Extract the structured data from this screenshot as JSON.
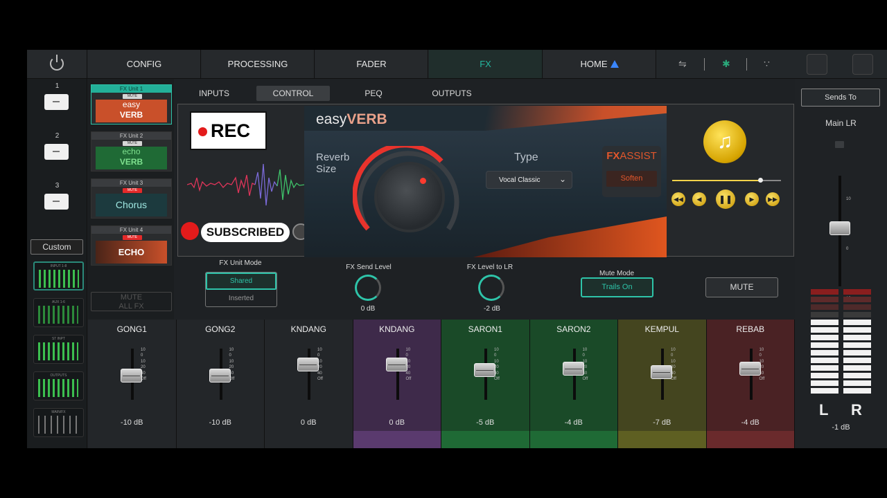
{
  "nav": {
    "tabs": [
      "CONFIG",
      "PROCESSING",
      "FADER",
      "FX",
      "HOME"
    ],
    "active": "FX"
  },
  "banks": [
    {
      "num": "1"
    },
    {
      "num": "2"
    },
    {
      "num": "3"
    }
  ],
  "left": {
    "custom_label": "Custom",
    "thumbs": [
      "INPUT 1-8",
      "AUX 1-6",
      "ST INPT",
      "OUTPUTS",
      "MAIN/FX"
    ]
  },
  "fx_units": [
    {
      "title": "FX Unit 1",
      "mute": "MUTE",
      "art_line1": "easy",
      "art_line2": "VERB",
      "mute_color": "#d6d6d6",
      "art_color": "#e2572c"
    },
    {
      "title": "FX Unit 2",
      "mute": "MUTE",
      "art_line1": "echo",
      "art_line2": "VERB",
      "mute_color": "#d6d6d6",
      "art_color": "#34b54a"
    },
    {
      "title": "FX Unit 3",
      "mute": "MUTE",
      "art_line1": "Chorus",
      "art_line2": "",
      "mute_color": "#e42a2a",
      "art_color": "#2aa8a0"
    },
    {
      "title": "FX Unit 4",
      "mute": "MUTE",
      "art_line1": "ECHO",
      "art_line2": "",
      "mute_color": "#e42a2a",
      "art_color": "#e2572c"
    }
  ],
  "mute_all": {
    "line1": "MUTE",
    "line2": "ALL FX"
  },
  "subtabs": [
    "INPUTS",
    "CONTROL",
    "PEQ",
    "OUTPUTS"
  ],
  "subtab_active": "CONTROL",
  "effect": {
    "brand_pre": "easy",
    "brand_main": "VERB",
    "knob_label": "Reverb Size",
    "type_label": "Type",
    "type_value": "Vocal Classic",
    "assist_title_a": "FX",
    "assist_title_b": "ASSIST",
    "assist_button": "Soften"
  },
  "overlay": {
    "rec_text": "REC",
    "subscribe_text": "SUBSCRIBED"
  },
  "controls": {
    "unit_mode_label": "FX Unit Mode",
    "unit_mode_options": [
      "Shared",
      "Inserted"
    ],
    "send_level_label": "FX Send Level",
    "send_level_value": "0 dB",
    "level_lr_label": "FX Level to LR",
    "level_lr_value": "-2 dB",
    "mute_mode_label": "Mute Mode",
    "mute_mode_value": "Trails On",
    "mute_button": "MUTE"
  },
  "scale_ticks": [
    "10",
    "0",
    "10",
    "20",
    "40",
    "Off"
  ],
  "strips": [
    {
      "name": "GONG1",
      "db": "-10 dB",
      "level": -10,
      "color": "#232629",
      "foot": "#232629"
    },
    {
      "name": "GONG2",
      "db": "-10 dB",
      "level": -10,
      "color": "#232629",
      "foot": "#232629"
    },
    {
      "name": "KNDANG",
      "db": "0 dB",
      "level": 0,
      "color": "#232629",
      "foot": "#232629"
    },
    {
      "name": "KNDANG",
      "db": "0 dB",
      "level": 0,
      "color": "#3e2a4a",
      "foot": "#5a3a6e"
    },
    {
      "name": "SARON1",
      "db": "-5 dB",
      "level": -5,
      "color": "#1a4a28",
      "foot": "#1f6a35"
    },
    {
      "name": "SARON2",
      "db": "-4 dB",
      "level": -4,
      "color": "#1a4a28",
      "foot": "#1f6a35"
    },
    {
      "name": "KEMPUL",
      "db": "-7 dB",
      "level": -7,
      "color": "#44451f",
      "foot": "#5e5f22"
    },
    {
      "name": "REBAB",
      "db": "-4 dB",
      "level": -4,
      "color": "#4a2224",
      "foot": "#6a2a2c"
    }
  ],
  "right": {
    "sends_label": "Sends To",
    "main_label": "Main LR",
    "l": "L",
    "r": "R",
    "db": "-1 dB",
    "scale": [
      "10",
      "0",
      "10"
    ]
  },
  "colors": {
    "accent": "#2ec4a9",
    "brand": "#e2572c"
  }
}
